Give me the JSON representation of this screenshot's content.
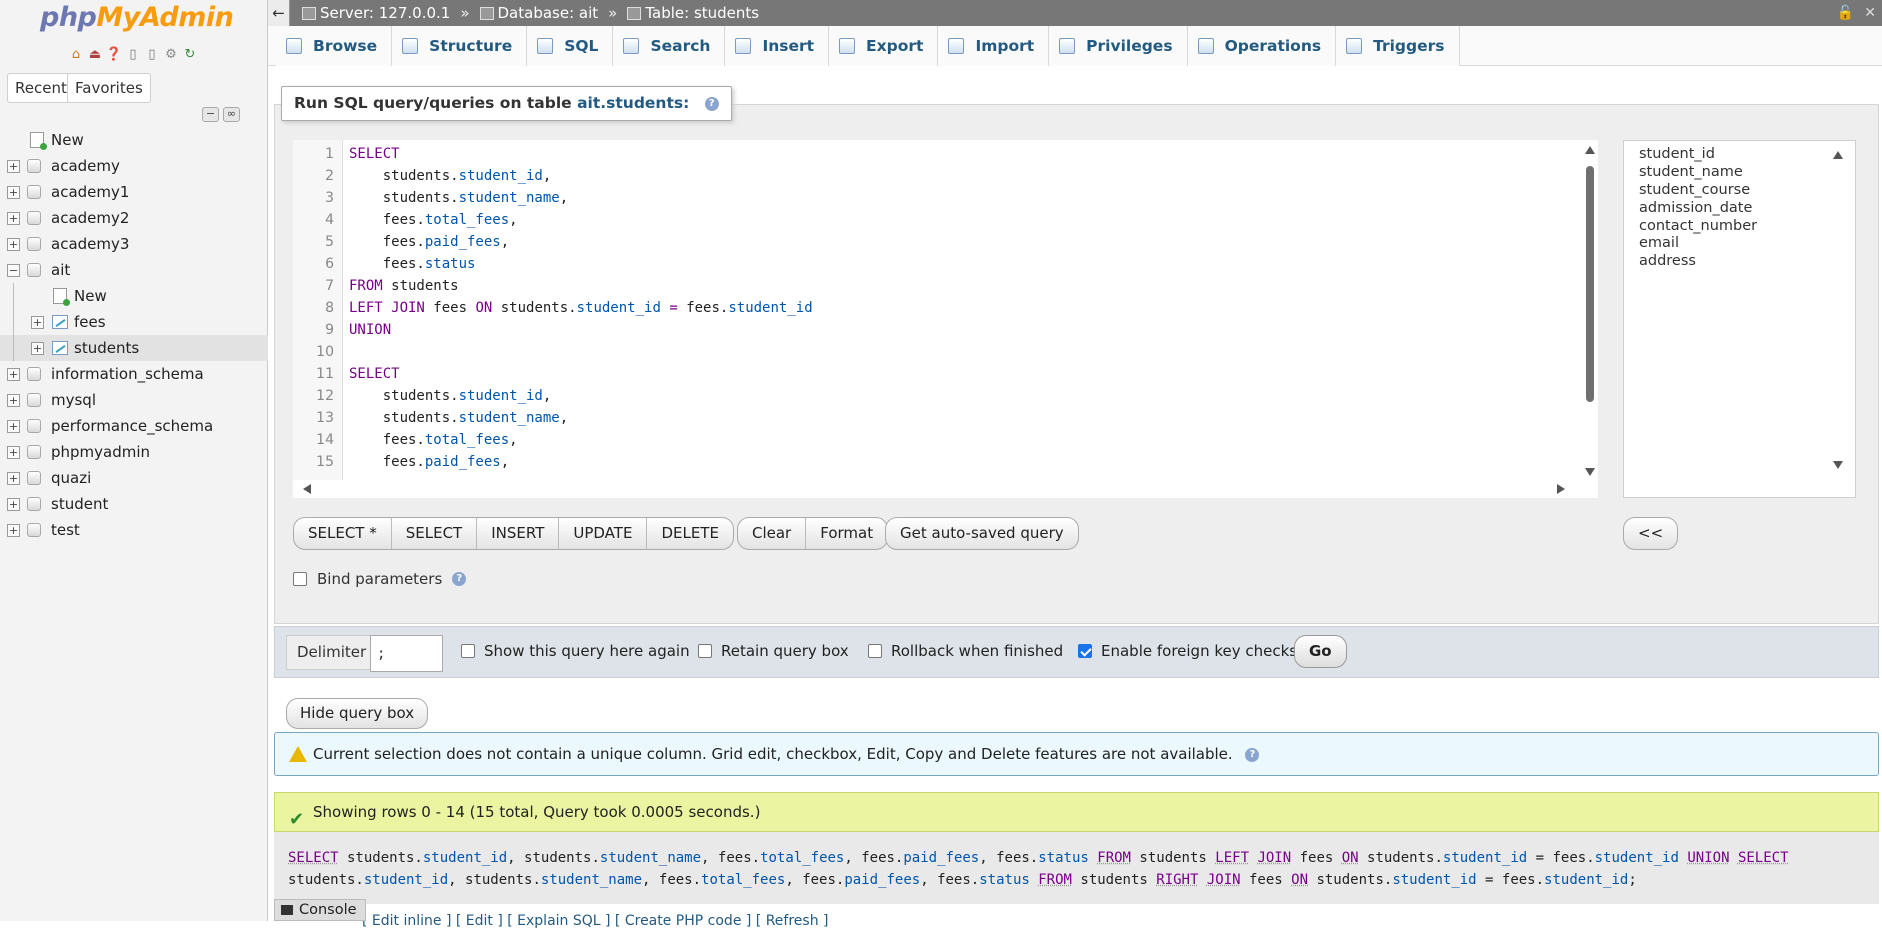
{
  "app": {
    "logo_php": "php",
    "logo_myadmin": "MyAdmin"
  },
  "nav": {
    "tabs": [
      "Recent",
      "Favorites"
    ],
    "tree": [
      {
        "label": "New",
        "type": "new",
        "level": 0
      },
      {
        "label": "academy",
        "type": "db",
        "level": 0
      },
      {
        "label": "academy1",
        "type": "db",
        "level": 0
      },
      {
        "label": "academy2",
        "type": "db",
        "level": 0
      },
      {
        "label": "academy3",
        "type": "db",
        "level": 0
      },
      {
        "label": "ait",
        "type": "db",
        "level": 0,
        "expanded": true
      },
      {
        "label": "New",
        "type": "new",
        "level": 1
      },
      {
        "label": "fees",
        "type": "table",
        "level": 1
      },
      {
        "label": "students",
        "type": "table",
        "level": 1,
        "selected": true
      },
      {
        "label": "information_schema",
        "type": "db",
        "level": 0
      },
      {
        "label": "mysql",
        "type": "db",
        "level": 0
      },
      {
        "label": "performance_schema",
        "type": "db",
        "level": 0
      },
      {
        "label": "phpmyadmin",
        "type": "db",
        "level": 0
      },
      {
        "label": "quazi",
        "type": "db",
        "level": 0
      },
      {
        "label": "student",
        "type": "db",
        "level": 0
      },
      {
        "label": "test",
        "type": "db",
        "level": 0
      }
    ]
  },
  "breadcrumb": {
    "server": "Server: 127.0.0.1",
    "database": "Database: ait",
    "table": "Table: students",
    "separator": "»"
  },
  "tabs": [
    "Browse",
    "Structure",
    "SQL",
    "Search",
    "Insert",
    "Export",
    "Import",
    "Privileges",
    "Operations",
    "Triggers"
  ],
  "query": {
    "legend_prefix": "Run SQL query/queries on table ",
    "legend_table": "ait.students:",
    "line_numbers": [
      "1",
      "2",
      "3",
      "4",
      "5",
      "6",
      "7",
      "8",
      "9",
      "10",
      "11",
      "12",
      "13",
      "14",
      "15"
    ],
    "fields": [
      "student_id",
      "student_name",
      "student_course",
      "admission_date",
      "contact_number",
      "email",
      "address"
    ],
    "buttons": [
      "SELECT *",
      "SELECT",
      "INSERT",
      "UPDATE",
      "DELETE"
    ],
    "clear": "Clear",
    "format": "Format",
    "autosaved": "Get auto-saved query",
    "insert_field": "<<",
    "bind_parameters": "Bind parameters"
  },
  "options": {
    "delimiter_label": "Delimiter",
    "delimiter_value": ";",
    "show_again": "Show this query here again",
    "retain_box": "Retain query box",
    "rollback": "Rollback when finished",
    "fk_checks": "Enable foreign key checks",
    "go": "Go"
  },
  "hide_query_box": "Hide query box",
  "notice": "Current selection does not contain a unique column. Grid edit, checkbox, Edit, Copy and Delete features are not available.",
  "success": "Showing rows 0 - 14 (15 total, Query took 0.0005 seconds.)",
  "links": "[ Edit inline ] [ Edit ] [ Explain SQL ] [ Create PHP code ] [ Refresh ]",
  "console": "Console"
}
